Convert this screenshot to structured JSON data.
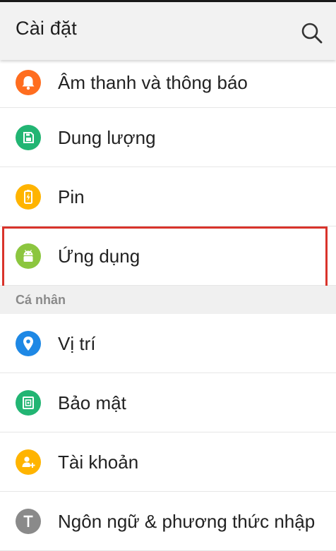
{
  "header": {
    "title": "Cài đặt",
    "search_icon": "search-icon"
  },
  "items_top": [
    {
      "label": "Âm thanh và thông báo",
      "icon": "bell-icon",
      "color": "#ff6d1f"
    },
    {
      "label": "Dung lượng",
      "icon": "storage-icon",
      "color": "#22b573"
    },
    {
      "label": "Pin",
      "icon": "battery-icon",
      "color": "#ffb400"
    },
    {
      "label": "Ứng dụng",
      "icon": "android-icon",
      "color": "#8cc63f",
      "highlighted": true
    }
  ],
  "section_personal": {
    "title": "Cá nhân"
  },
  "items_personal": [
    {
      "label": "Vị trí",
      "icon": "location-pin-icon",
      "color": "#1e88e5"
    },
    {
      "label": "Bảo mật",
      "icon": "security-icon",
      "color": "#22b573"
    },
    {
      "label": "Tài khoản",
      "icon": "account-add-icon",
      "color": "#ffb400"
    },
    {
      "label": "Ngôn ngữ & phương thức nhập",
      "icon": "language-icon",
      "color": "#8a8a8a"
    }
  ],
  "colors": {
    "highlight_border": "#d9332b",
    "app_bar_bg": "#f2f2f2",
    "section_bg": "#f0f0f0"
  }
}
